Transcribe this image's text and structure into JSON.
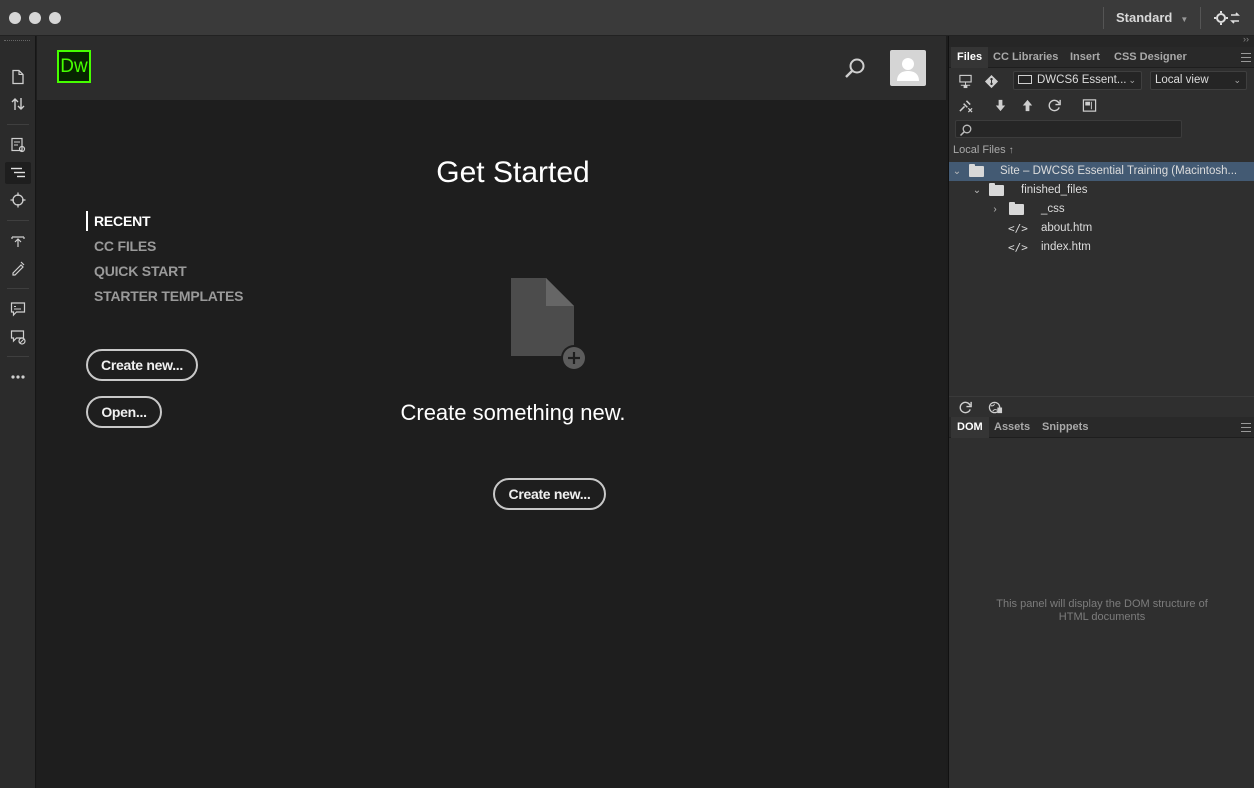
{
  "window": {
    "workspace_label": "Standard"
  },
  "main": {
    "logo_text": "Dw",
    "heading": "Get Started",
    "nav": [
      "RECENT",
      "CC FILES",
      "QUICK START",
      "STARTER TEMPLATES"
    ],
    "create_new_label": "Create new...",
    "open_label": "Open...",
    "empty_state_text": "Create something new.",
    "center_create_new_label": "Create new..."
  },
  "files_panel": {
    "tabs": [
      "Files",
      "CC Libraries",
      "Insert",
      "CSS Designer"
    ],
    "site_dropdown": "DWCS6 Essent...",
    "view_dropdown": "Local view",
    "local_files_label": "Local Files",
    "tree": [
      {
        "label": "Site – DWCS6 Essential Training (Macintosh...",
        "type": "site"
      },
      {
        "label": "finished_files",
        "type": "folder"
      },
      {
        "label": "_css",
        "type": "folder"
      },
      {
        "label": "about.htm",
        "type": "file"
      },
      {
        "label": "index.htm",
        "type": "file"
      }
    ]
  },
  "dom_panel": {
    "tabs": [
      "DOM",
      "Assets",
      "Snippets"
    ],
    "empty_line1": "This panel will display the DOM structure of",
    "empty_line2": "HTML documents"
  },
  "colors": {
    "dw_brand": "#46ff00",
    "selection": "#435a73"
  }
}
